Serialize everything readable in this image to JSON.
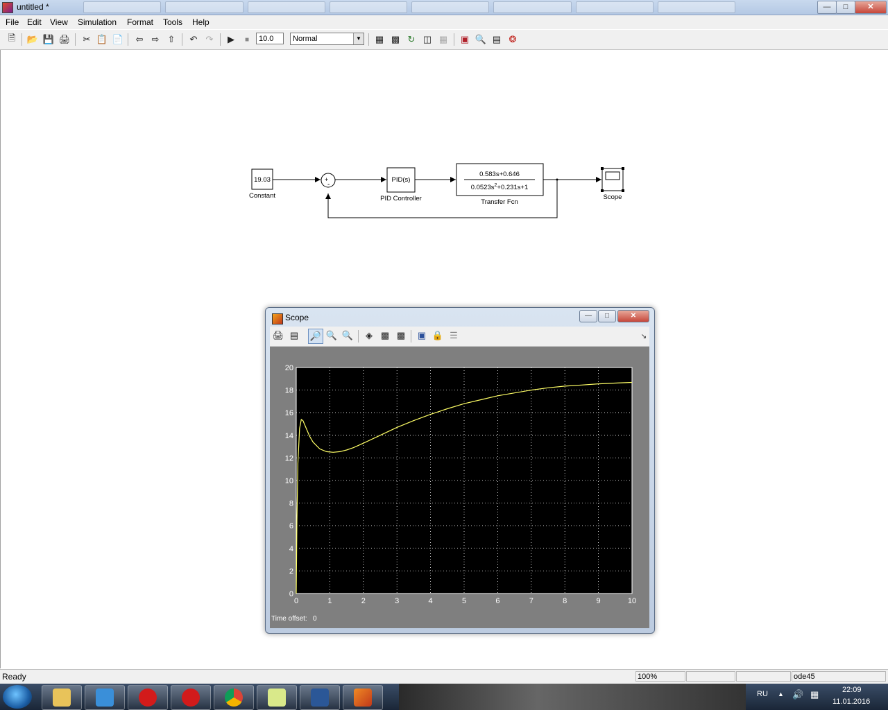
{
  "window": {
    "title": "untitled *"
  },
  "menu": [
    "File",
    "Edit",
    "View",
    "Simulation",
    "Format",
    "Tools",
    "Help"
  ],
  "toolbar": {
    "stop_time": "10.0",
    "sim_mode": "Normal"
  },
  "model": {
    "constant": {
      "value": "19.03",
      "label": "Constant"
    },
    "sum": {
      "signs": [
        "+",
        "-"
      ]
    },
    "pid": {
      "text": "PID(s)",
      "label": "PID Controller"
    },
    "transfer_fcn": {
      "num": "0.583s+0.646",
      "den_a": "0.0523s",
      "den_exp": "2",
      "den_b": "+0.231s+1",
      "label": "Transfer Fcn"
    },
    "scope": {
      "label": "Scope"
    }
  },
  "scope_window": {
    "title": "Scope",
    "time_offset_label": "Time offset:",
    "time_offset_value": "0"
  },
  "status": {
    "left": "Ready",
    "zoom": "100%",
    "solver": "ode45"
  },
  "taskbar": {
    "lang": "RU",
    "time": "22:09",
    "date": "11.01.2016"
  },
  "chart_data": {
    "type": "line",
    "xlim": [
      0,
      10
    ],
    "ylim": [
      0,
      20
    ],
    "xticks": [
      0,
      1,
      2,
      3,
      4,
      5,
      6,
      7,
      8,
      9,
      10
    ],
    "yticks": [
      0,
      2,
      4,
      6,
      8,
      10,
      12,
      14,
      16,
      18,
      20
    ],
    "grid": true,
    "line_color": "#ffff66",
    "background": "#000000",
    "series": [
      {
        "x": [
          0,
          0.02,
          0.05,
          0.1,
          0.15,
          0.2,
          0.3,
          0.4,
          0.5,
          0.7,
          0.9,
          1.1,
          1.3,
          1.5,
          1.7,
          2.0,
          2.5,
          3.0,
          3.5,
          4.0,
          4.5,
          5.0,
          5.5,
          6.0,
          6.5,
          7.0,
          7.5,
          8.0,
          8.5,
          9.0,
          9.5,
          10.0
        ],
        "y": [
          0,
          6.5,
          11.5,
          14.6,
          15.4,
          15.3,
          14.6,
          13.9,
          13.4,
          12.8,
          12.55,
          12.5,
          12.55,
          12.7,
          12.9,
          13.3,
          14.0,
          14.7,
          15.3,
          15.85,
          16.35,
          16.8,
          17.15,
          17.5,
          17.75,
          18.0,
          18.2,
          18.35,
          18.45,
          18.55,
          18.62,
          18.68
        ]
      }
    ]
  }
}
